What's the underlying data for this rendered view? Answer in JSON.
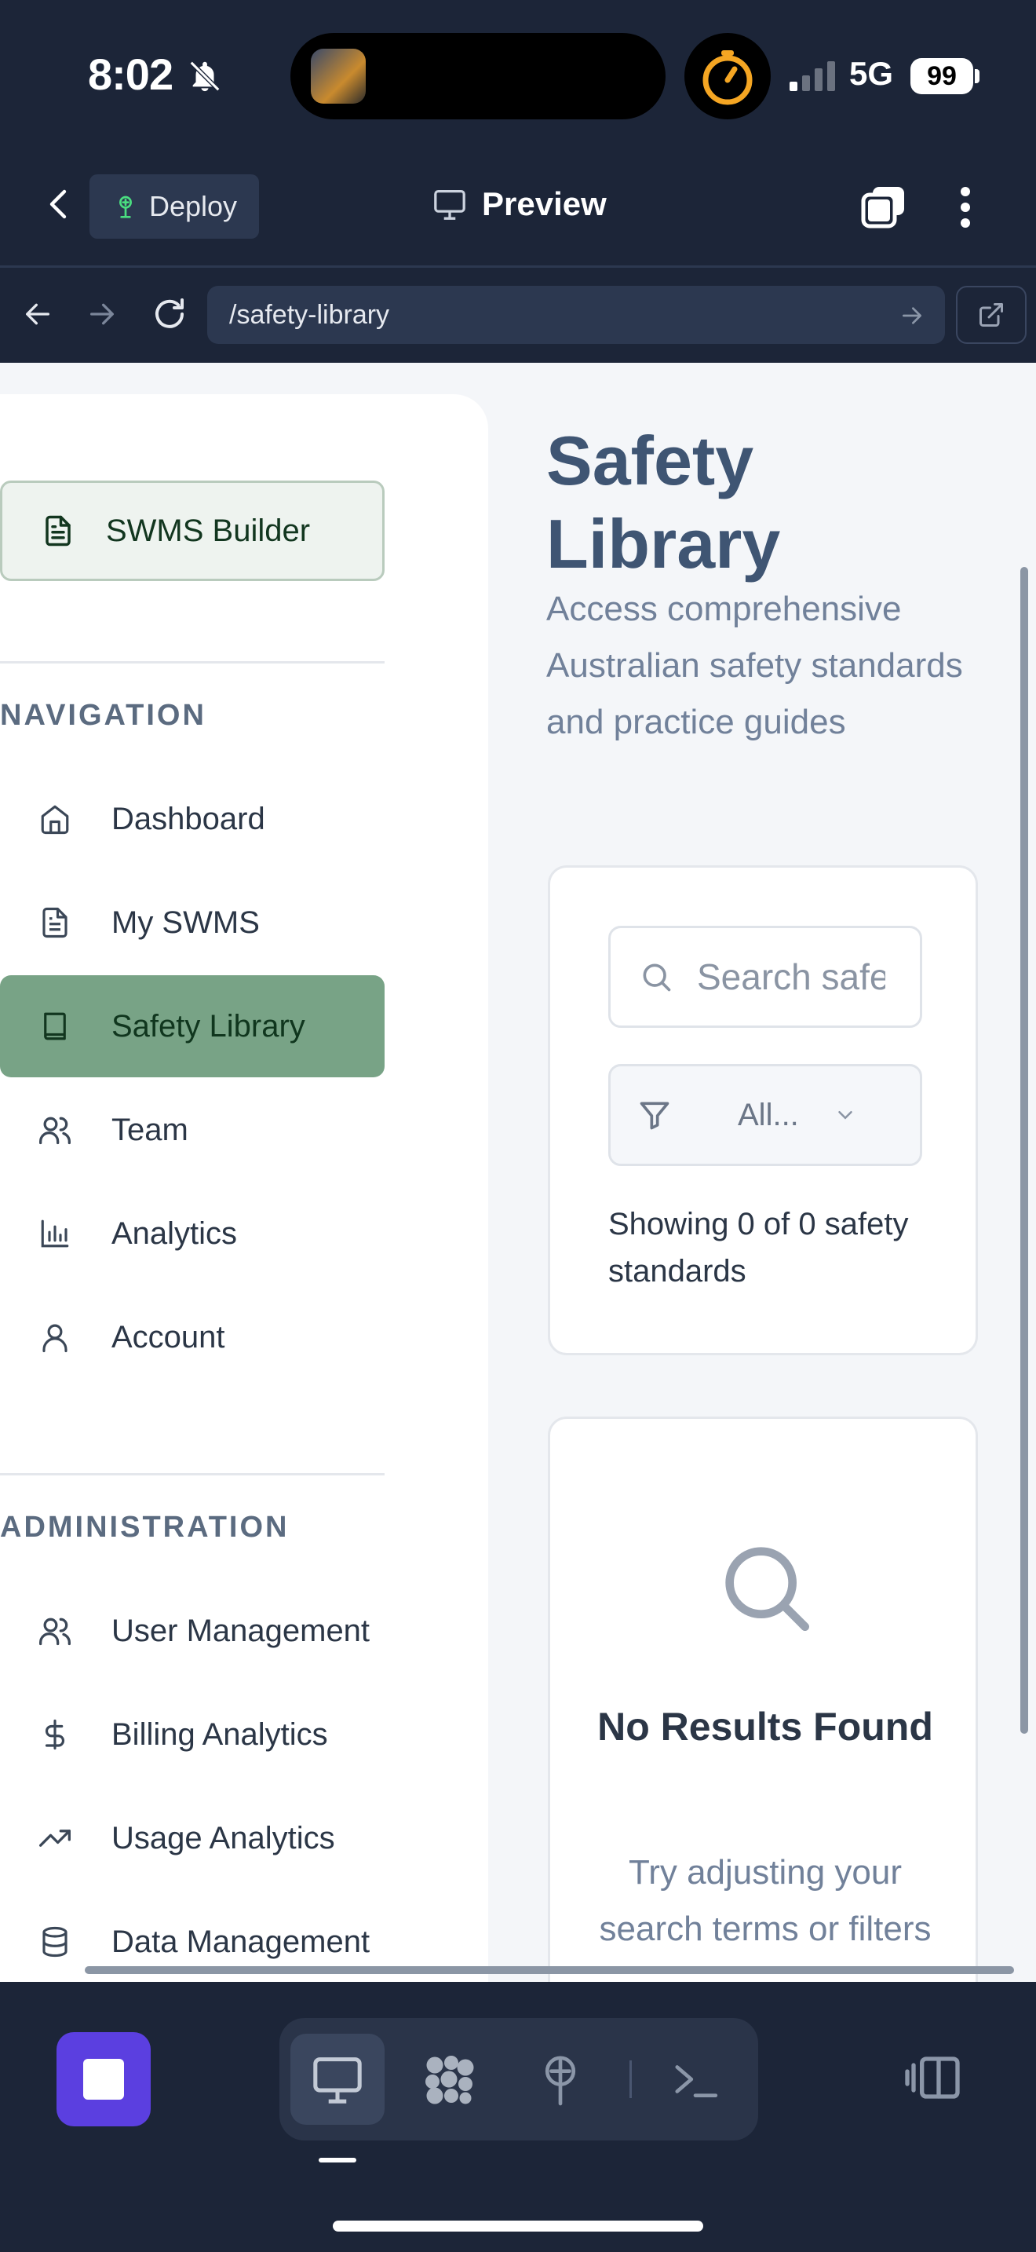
{
  "status": {
    "time": "8:02",
    "network": "5G",
    "battery": "99"
  },
  "appbar": {
    "deploy_label": "Deploy",
    "preview_label": "Preview"
  },
  "browser": {
    "url": "/safety-library"
  },
  "sidebar": {
    "builder_label": "SWMS Builder",
    "navigation_heading": "NAVIGATION",
    "navigation": [
      {
        "label": "Dashboard",
        "icon": "home-icon"
      },
      {
        "label": "My SWMS",
        "icon": "document-icon"
      },
      {
        "label": "Safety Library",
        "icon": "book-icon",
        "active": true
      },
      {
        "label": "Team",
        "icon": "users-icon"
      },
      {
        "label": "Analytics",
        "icon": "bar-chart-icon"
      },
      {
        "label": "Account",
        "icon": "user-icon"
      }
    ],
    "administration_heading": "ADMINISTRATION",
    "administration": [
      {
        "label": "User Management",
        "icon": "users-icon"
      },
      {
        "label": "Billing Analytics",
        "icon": "dollar-icon"
      },
      {
        "label": "Usage Analytics",
        "icon": "trending-up-icon"
      },
      {
        "label": "Data Management",
        "icon": "database-icon"
      }
    ]
  },
  "main": {
    "title": "Safety Library",
    "subtitle": "Access comprehensive Australian safety standards and practice guides",
    "search_placeholder": "Search safety standards...",
    "filter_value": "All...",
    "count_text": "Showing 0 of 0 safety standards",
    "empty_title": "No Results Found",
    "empty_subtitle": "Try adjusting your search terms or filters"
  },
  "colors": {
    "accent": "#5b3fe0",
    "active_nav": "#78a386",
    "title": "#3f5573",
    "chrome": "#1c2538"
  }
}
